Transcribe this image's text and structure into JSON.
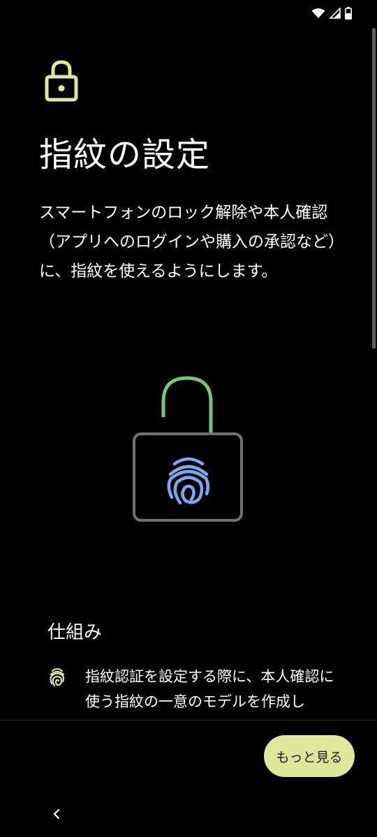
{
  "page": {
    "title": "指紋の設定",
    "description": "スマートフォンのロック解除や本人確認（アプリへのログインや購入の承認など）に、指紋を使えるようにします。"
  },
  "how_it_works": {
    "heading": "仕組み",
    "item_text": "指紋認証を設定する際に、本人確認に使う指紋の一意のモデルを作成し"
  },
  "footer": {
    "more_button_label": "もっと見る"
  },
  "colors": {
    "accent_yellow": "#dfe89a",
    "shackle_green": "#7cc27a",
    "fingerprint_blue": "#7ba7ef",
    "lock_body_gray": "#707070"
  },
  "icons": {
    "header": "lock-icon",
    "illustration": "unlocked-padlock-fingerprint",
    "list_item": "fingerprint-icon",
    "back": "chevron-left-icon"
  }
}
